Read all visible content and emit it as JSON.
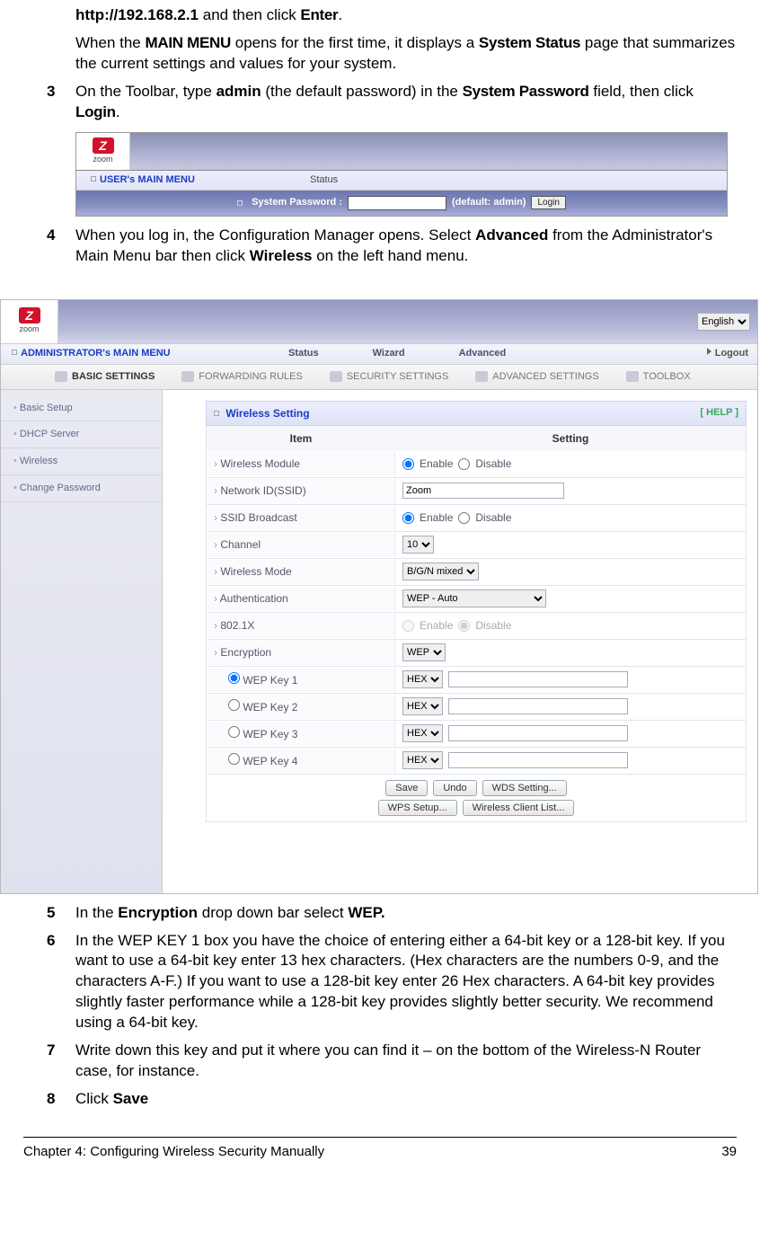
{
  "intro": {
    "line1_pre": "http://192.168.2.1",
    "line1_mid": " and then click ",
    "line1_enter": "Enter",
    "line1_end": ".",
    "line2_a": "When the ",
    "line2_mm": "MAIN MENU",
    "line2_b": " opens for the first time, it displays a ",
    "line2_ss": "System Status",
    "line2_c": " page that summarizes the current settings and values for your system."
  },
  "step3": {
    "num": "3",
    "a": "On the Toolbar, type ",
    "admin": "admin",
    "b": " (the default password) in the ",
    "sp": "System Password",
    "c": " field, then click ",
    "login": "Login",
    "d": "."
  },
  "loginshot": {
    "brand": "zoom",
    "menu": "USER's MAIN MENU",
    "status": "Status",
    "sp_label": "System Password :",
    "sp_hint": "(default: admin)",
    "login_btn": "Login"
  },
  "step4": {
    "num": "4",
    "a": "When you log in, the Configuration Manager opens. Select ",
    "adv": "Advanced",
    "b": " from the Administrator's Main Menu bar then click ",
    "wl": "Wireless",
    "c": " on the left hand menu."
  },
  "adminshot": {
    "lang": "English",
    "brand": "zoom",
    "menu": "ADMINISTRATOR's MAIN MENU",
    "nav": {
      "status": "Status",
      "wizard": "Wizard",
      "advanced": "Advanced",
      "logout": "Logout"
    },
    "tabs": {
      "basic": "BASIC SETTINGS",
      "fwd": "FORWARDING RULES",
      "sec": "SECURITY SETTINGS",
      "adv": "ADVANCED SETTINGS",
      "tool": "TOOLBOX"
    },
    "sidebar": [
      "Basic Setup",
      "DHCP Server",
      "Wireless",
      "Change Password"
    ],
    "section": {
      "title": "Wireless Setting",
      "help": "[ HELP ]"
    },
    "cols": {
      "item": "Item",
      "setting": "Setting"
    },
    "rows": {
      "wm": {
        "lbl": "Wireless Module",
        "enable": "Enable",
        "disable": "Disable"
      },
      "ssid": {
        "lbl": "Network ID(SSID)",
        "val": "Zoom"
      },
      "bcast": {
        "lbl": "SSID Broadcast",
        "enable": "Enable",
        "disable": "Disable"
      },
      "chan": {
        "lbl": "Channel",
        "val": "10"
      },
      "mode": {
        "lbl": "Wireless Mode",
        "val": "B/G/N mixed"
      },
      "auth": {
        "lbl": "Authentication",
        "val": "WEP - Auto"
      },
      "dot1x": {
        "lbl": "802.1X",
        "enable": "Enable",
        "disable": "Disable"
      },
      "enc": {
        "lbl": "Encryption",
        "val": "WEP"
      },
      "k1": {
        "lbl": "WEP Key 1",
        "fmt": "HEX"
      },
      "k2": {
        "lbl": "WEP Key 2",
        "fmt": "HEX"
      },
      "k3": {
        "lbl": "WEP Key 3",
        "fmt": "HEX"
      },
      "k4": {
        "lbl": "WEP Key 4",
        "fmt": "HEX"
      }
    },
    "buttons": {
      "save": "Save",
      "undo": "Undo",
      "wds": "WDS Setting...",
      "wps": "WPS Setup...",
      "wcl": "Wireless Client List..."
    }
  },
  "step5": {
    "num": "5",
    "a": "In the ",
    "enc": "Encryption",
    "b": " drop down bar select ",
    "wep": "WEP."
  },
  "step6": {
    "num": "6",
    "text": "In the WEP KEY 1 box you have the choice of entering either a 64-bit key or a 128-bit key. If you want to use a 64-bit key enter 13 hex characters. (Hex characters are the numbers 0-9, and the characters A-F.) If you want to use a 128-bit key enter 26 Hex characters. A 64-bit key provides slightly faster performance while a 128-bit key provides slightly better security. We recommend using a 64-bit key."
  },
  "step7": {
    "num": "7",
    "text": "Write down this key and put it where you can find it – on the bottom of the Wireless-N Router case, for instance."
  },
  "step8": {
    "num": "8",
    "a": "Click ",
    "save": "Save"
  },
  "footer": {
    "chapter": "Chapter 4: Configuring Wireless Security Manually",
    "page": "39"
  }
}
